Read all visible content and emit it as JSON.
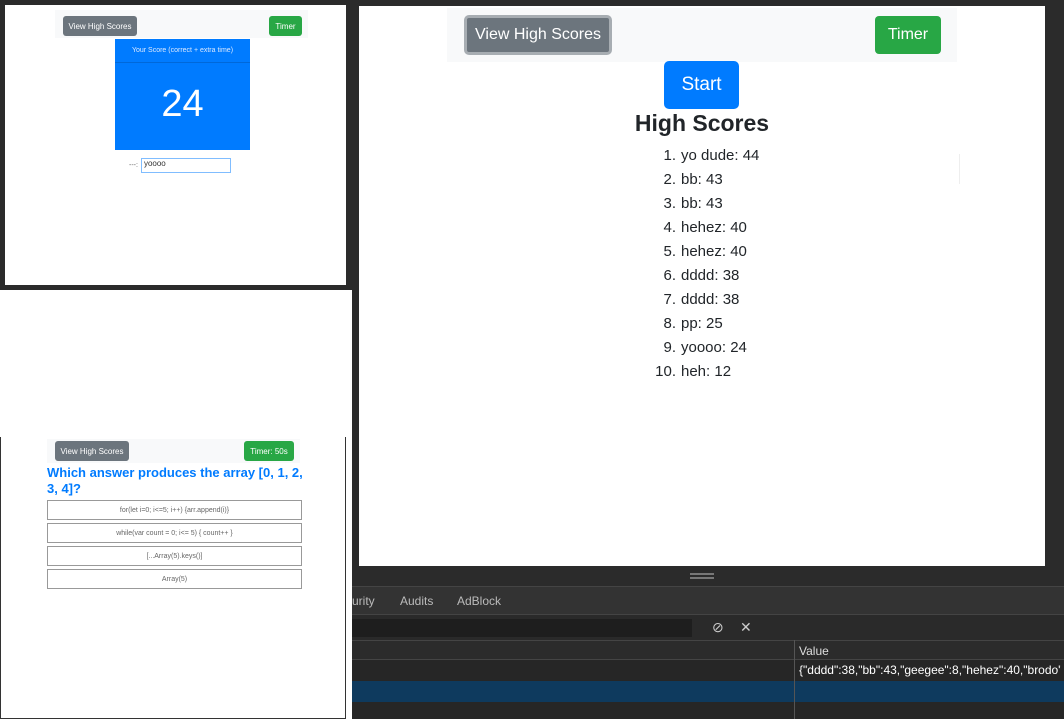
{
  "score_window": {
    "view_high_scores_label": "View High Scores",
    "timer_label": "Timer",
    "score_header": "Your Score (correct + extra time)",
    "score_value": "24",
    "name_label": "---:",
    "name_value": "yoooo"
  },
  "quiz_window": {
    "view_high_scores_label": "View High Scores",
    "timer_label": "Timer: 50s",
    "question": "Which answer produces the array [0, 1, 2, 3, 4]?",
    "answers": [
      "for(let i=0; i<=5; i++) {arr.append(i)}",
      "while(var count = 0; i<= 5) { count++ }",
      "[...Array(5).keys()]",
      "Array(5)"
    ]
  },
  "main_page": {
    "view_high_scores_label": "View High Scores",
    "timer_label": "Timer",
    "start_label": "Start",
    "high_scores_title": "High Scores",
    "scores": [
      {
        "num": "1.",
        "text": "yo dude: 44"
      },
      {
        "num": "2.",
        "text": "bb: 43"
      },
      {
        "num": "3.",
        "text": "bb: 43"
      },
      {
        "num": "4.",
        "text": "hehez: 40"
      },
      {
        "num": "5.",
        "text": "hehez: 40"
      },
      {
        "num": "6.",
        "text": "dddd: 38"
      },
      {
        "num": "7.",
        "text": "dddd: 38"
      },
      {
        "num": "8.",
        "text": "pp: 25"
      },
      {
        "num": "9.",
        "text": "yoooo: 24"
      },
      {
        "num": "10.",
        "text": "heh: 12"
      }
    ]
  },
  "devtools": {
    "tabs": [
      "urity",
      "Audits",
      "AdBlock"
    ],
    "value_header": "Value",
    "value_cell": "{\"dddd\":38,\"bb\":43,\"geegee\":8,\"hehez\":40,\"brodo\"",
    "block_icon": "block-icon",
    "clear_icon": "close-icon"
  }
}
